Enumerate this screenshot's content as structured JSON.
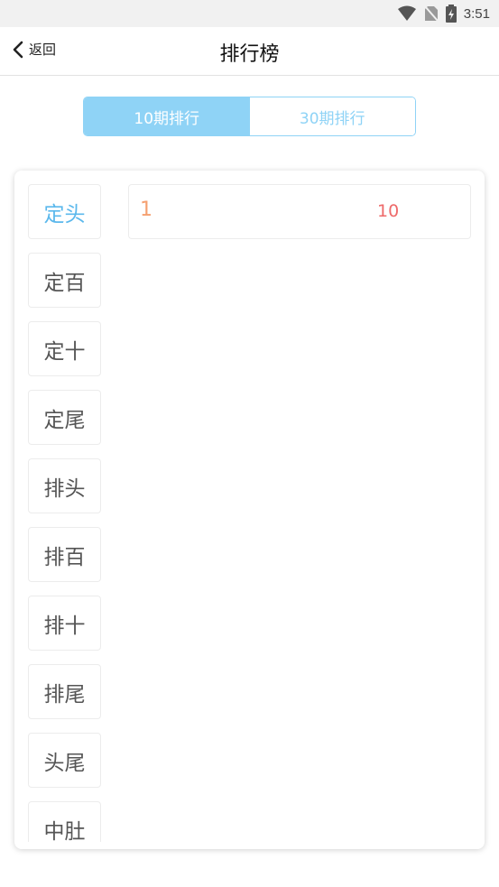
{
  "status_bar": {
    "time": "3:51",
    "icons": [
      "wifi-icon",
      "no-sim-icon",
      "battery-charging-icon"
    ]
  },
  "nav": {
    "back_label": "返回",
    "title": "排行榜"
  },
  "tabs": [
    {
      "label": "10期排行",
      "active": true
    },
    {
      "label": "30期排行",
      "active": false
    }
  ],
  "categories": [
    {
      "label": "定头",
      "active": true
    },
    {
      "label": "定百",
      "active": false
    },
    {
      "label": "定十",
      "active": false
    },
    {
      "label": "定尾",
      "active": false
    },
    {
      "label": "排头",
      "active": false
    },
    {
      "label": "排百",
      "active": false
    },
    {
      "label": "排十",
      "active": false
    },
    {
      "label": "排尾",
      "active": false
    },
    {
      "label": "头尾",
      "active": false
    },
    {
      "label": "中肚",
      "active": false
    }
  ],
  "results": [
    {
      "rank": "1",
      "value": "10"
    }
  ],
  "colors": {
    "accent": "#8fd3f6",
    "active_text": "#5bb8ec",
    "rank": "#f5a070",
    "value": "#ee6a6a"
  }
}
